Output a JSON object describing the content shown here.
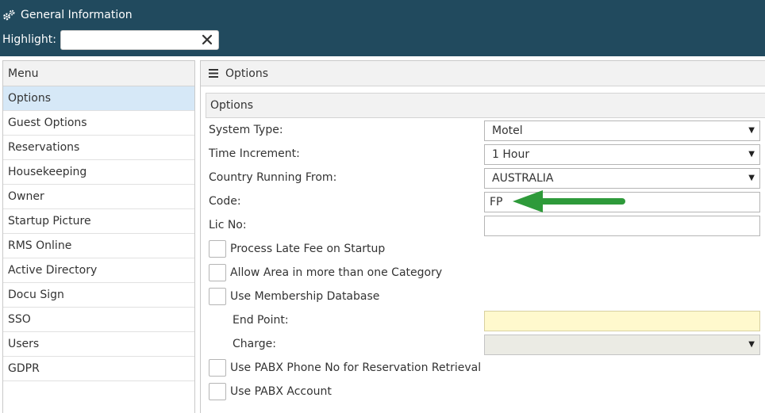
{
  "header": {
    "title": "General Information",
    "highlight_label": "Highlight:",
    "highlight_value": ""
  },
  "menu": {
    "header": "Menu",
    "items": [
      {
        "label": "Options",
        "active": true
      },
      {
        "label": "Guest Options"
      },
      {
        "label": "Reservations"
      },
      {
        "label": "Housekeeping"
      },
      {
        "label": "Owner"
      },
      {
        "label": "Startup Picture"
      },
      {
        "label": "RMS Online"
      },
      {
        "label": "Active Directory"
      },
      {
        "label": "Docu Sign"
      },
      {
        "label": "SSO"
      },
      {
        "label": "Users"
      },
      {
        "label": "GDPR"
      }
    ]
  },
  "panel": {
    "header": "Options",
    "section": "Options",
    "system_type": {
      "label": "System Type:",
      "value": "Motel"
    },
    "time_increment": {
      "label": "Time Increment:",
      "value": "1 Hour"
    },
    "country": {
      "label": "Country Running From:",
      "value": "AUSTRALIA"
    },
    "code": {
      "label": "Code:",
      "value": "FP"
    },
    "lic_no": {
      "label": "Lic No:",
      "value": ""
    },
    "checkboxes": {
      "late_fee": "Process Late Fee on Startup",
      "allow_area": "Allow Area in more than one Category",
      "membership": "Use Membership Database",
      "pabx_phone": "Use PABX Phone No for Reservation Retrieval",
      "pabx_account": "Use PABX Account"
    },
    "end_point": {
      "label": "End Point:",
      "value": ""
    },
    "charge": {
      "label": "Charge:",
      "value": ""
    }
  },
  "colors": {
    "header_bg": "#214a5e",
    "active_menu_bg": "#d6e8f7",
    "arrow": "#2e9a3a",
    "endpoint_bg": "#fff9cd"
  },
  "icons": [
    "gear-icon",
    "clear-icon",
    "hamburger-icon",
    "chevron-down-icon",
    "arrow-annotation"
  ]
}
